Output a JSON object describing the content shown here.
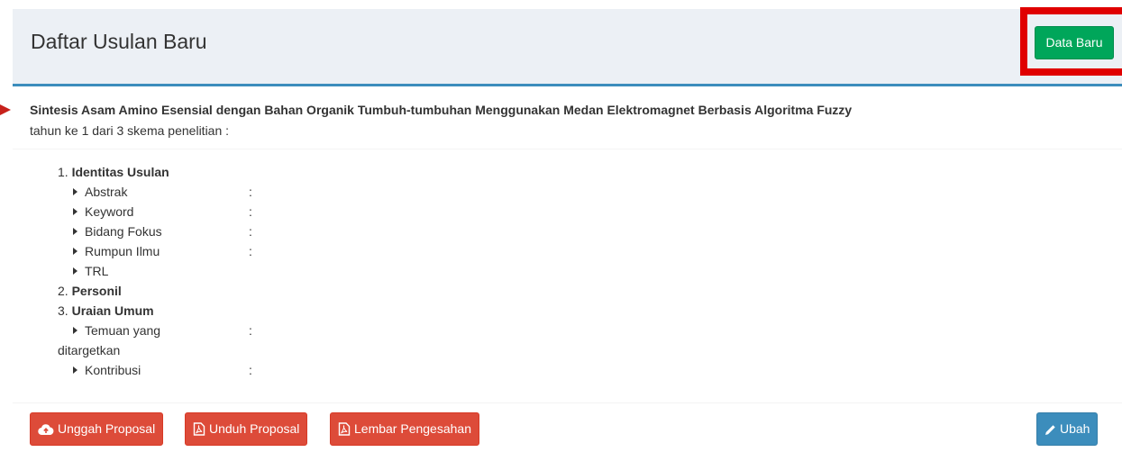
{
  "header": {
    "title": "Daftar Usulan Baru",
    "new_button_label": "Data Baru"
  },
  "proposal": {
    "title": "Sintesis Asam Amino Esensial dengan Bahan Organik Tumbuh-tumbuhan Menggunakan Medan Elektromagnet Berbasis Algoritma Fuzzy",
    "scheme_info": "tahun ke 1 dari 3 skema penelitian :"
  },
  "sections": [
    {
      "number": "1.",
      "label": "Identitas Usulan",
      "items": [
        {
          "label": "Abstrak",
          "value": ":"
        },
        {
          "label": "Keyword",
          "value": ":"
        },
        {
          "label": "Bidang Fokus",
          "value": ":"
        },
        {
          "label": "Rumpun Ilmu",
          "value": ":"
        },
        {
          "label": "TRL",
          "value": ""
        }
      ]
    },
    {
      "number": "2.",
      "label": "Personil",
      "items": []
    },
    {
      "number": "3.",
      "label": "Uraian Umum",
      "items": [
        {
          "label": "Temuan yang",
          "label_cont": "ditargetkan",
          "value": ":"
        },
        {
          "label": "Kontribusi",
          "value": ":"
        }
      ]
    }
  ],
  "footer": {
    "upload_label": "Unggah Proposal",
    "download_label": "Unduh Proposal",
    "approval_sheet_label": "Lembar Pengesahan",
    "edit_label": "Ubah"
  },
  "colors": {
    "success": "#00a65a",
    "danger": "#dd4b39",
    "primary": "#3c8dbc",
    "highlight": "#e00000"
  },
  "icons": {
    "upload": "cloud-upload-icon",
    "download": "file-pdf-icon",
    "approval": "file-pdf-icon",
    "edit": "pencil-icon",
    "bullet": "caret-right-icon"
  }
}
